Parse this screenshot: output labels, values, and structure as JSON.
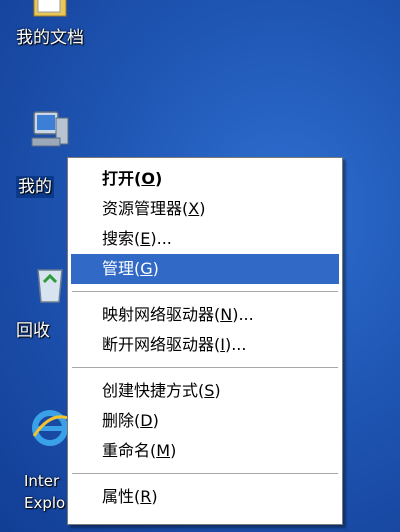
{
  "desktop": {
    "icons": [
      {
        "label": "我的文档",
        "icon": "folder-documents-icon"
      },
      {
        "label": "我的电脑",
        "icon": "computer-icon"
      },
      {
        "label": "回收站",
        "icon": "recycle-bin-icon"
      },
      {
        "label": "Internet Explorer",
        "label_line1": "Inter",
        "label_line2": "Explo",
        "icon": "internet-explorer-icon"
      }
    ],
    "visible_labels": {
      "computer": "我的",
      "recycle": "回收"
    }
  },
  "context_menu": {
    "groups": [
      [
        {
          "label": "打开(",
          "accel": "O",
          "suffix": ")",
          "bold": true
        },
        {
          "label": "资源管理器(",
          "accel": "X",
          "suffix": ")"
        },
        {
          "label": "搜索(",
          "accel": "E",
          "suffix": ")..."
        },
        {
          "label": "管理(",
          "accel": "G",
          "suffix": ")",
          "highlighted": true
        }
      ],
      [
        {
          "label": "映射网络驱动器(",
          "accel": "N",
          "suffix": ")..."
        },
        {
          "label": "断开网络驱动器(",
          "accel": "I",
          "suffix": ")..."
        }
      ],
      [
        {
          "label": "创建快捷方式(",
          "accel": "S",
          "suffix": ")"
        },
        {
          "label": "删除(",
          "accel": "D",
          "suffix": ")"
        },
        {
          "label": "重命名(",
          "accel": "M",
          "suffix": ")"
        }
      ],
      [
        {
          "label": "属性(",
          "accel": "R",
          "suffix": ")"
        }
      ]
    ]
  },
  "colors": {
    "highlight": "#3169c6",
    "desktop": "#1f56b4"
  }
}
